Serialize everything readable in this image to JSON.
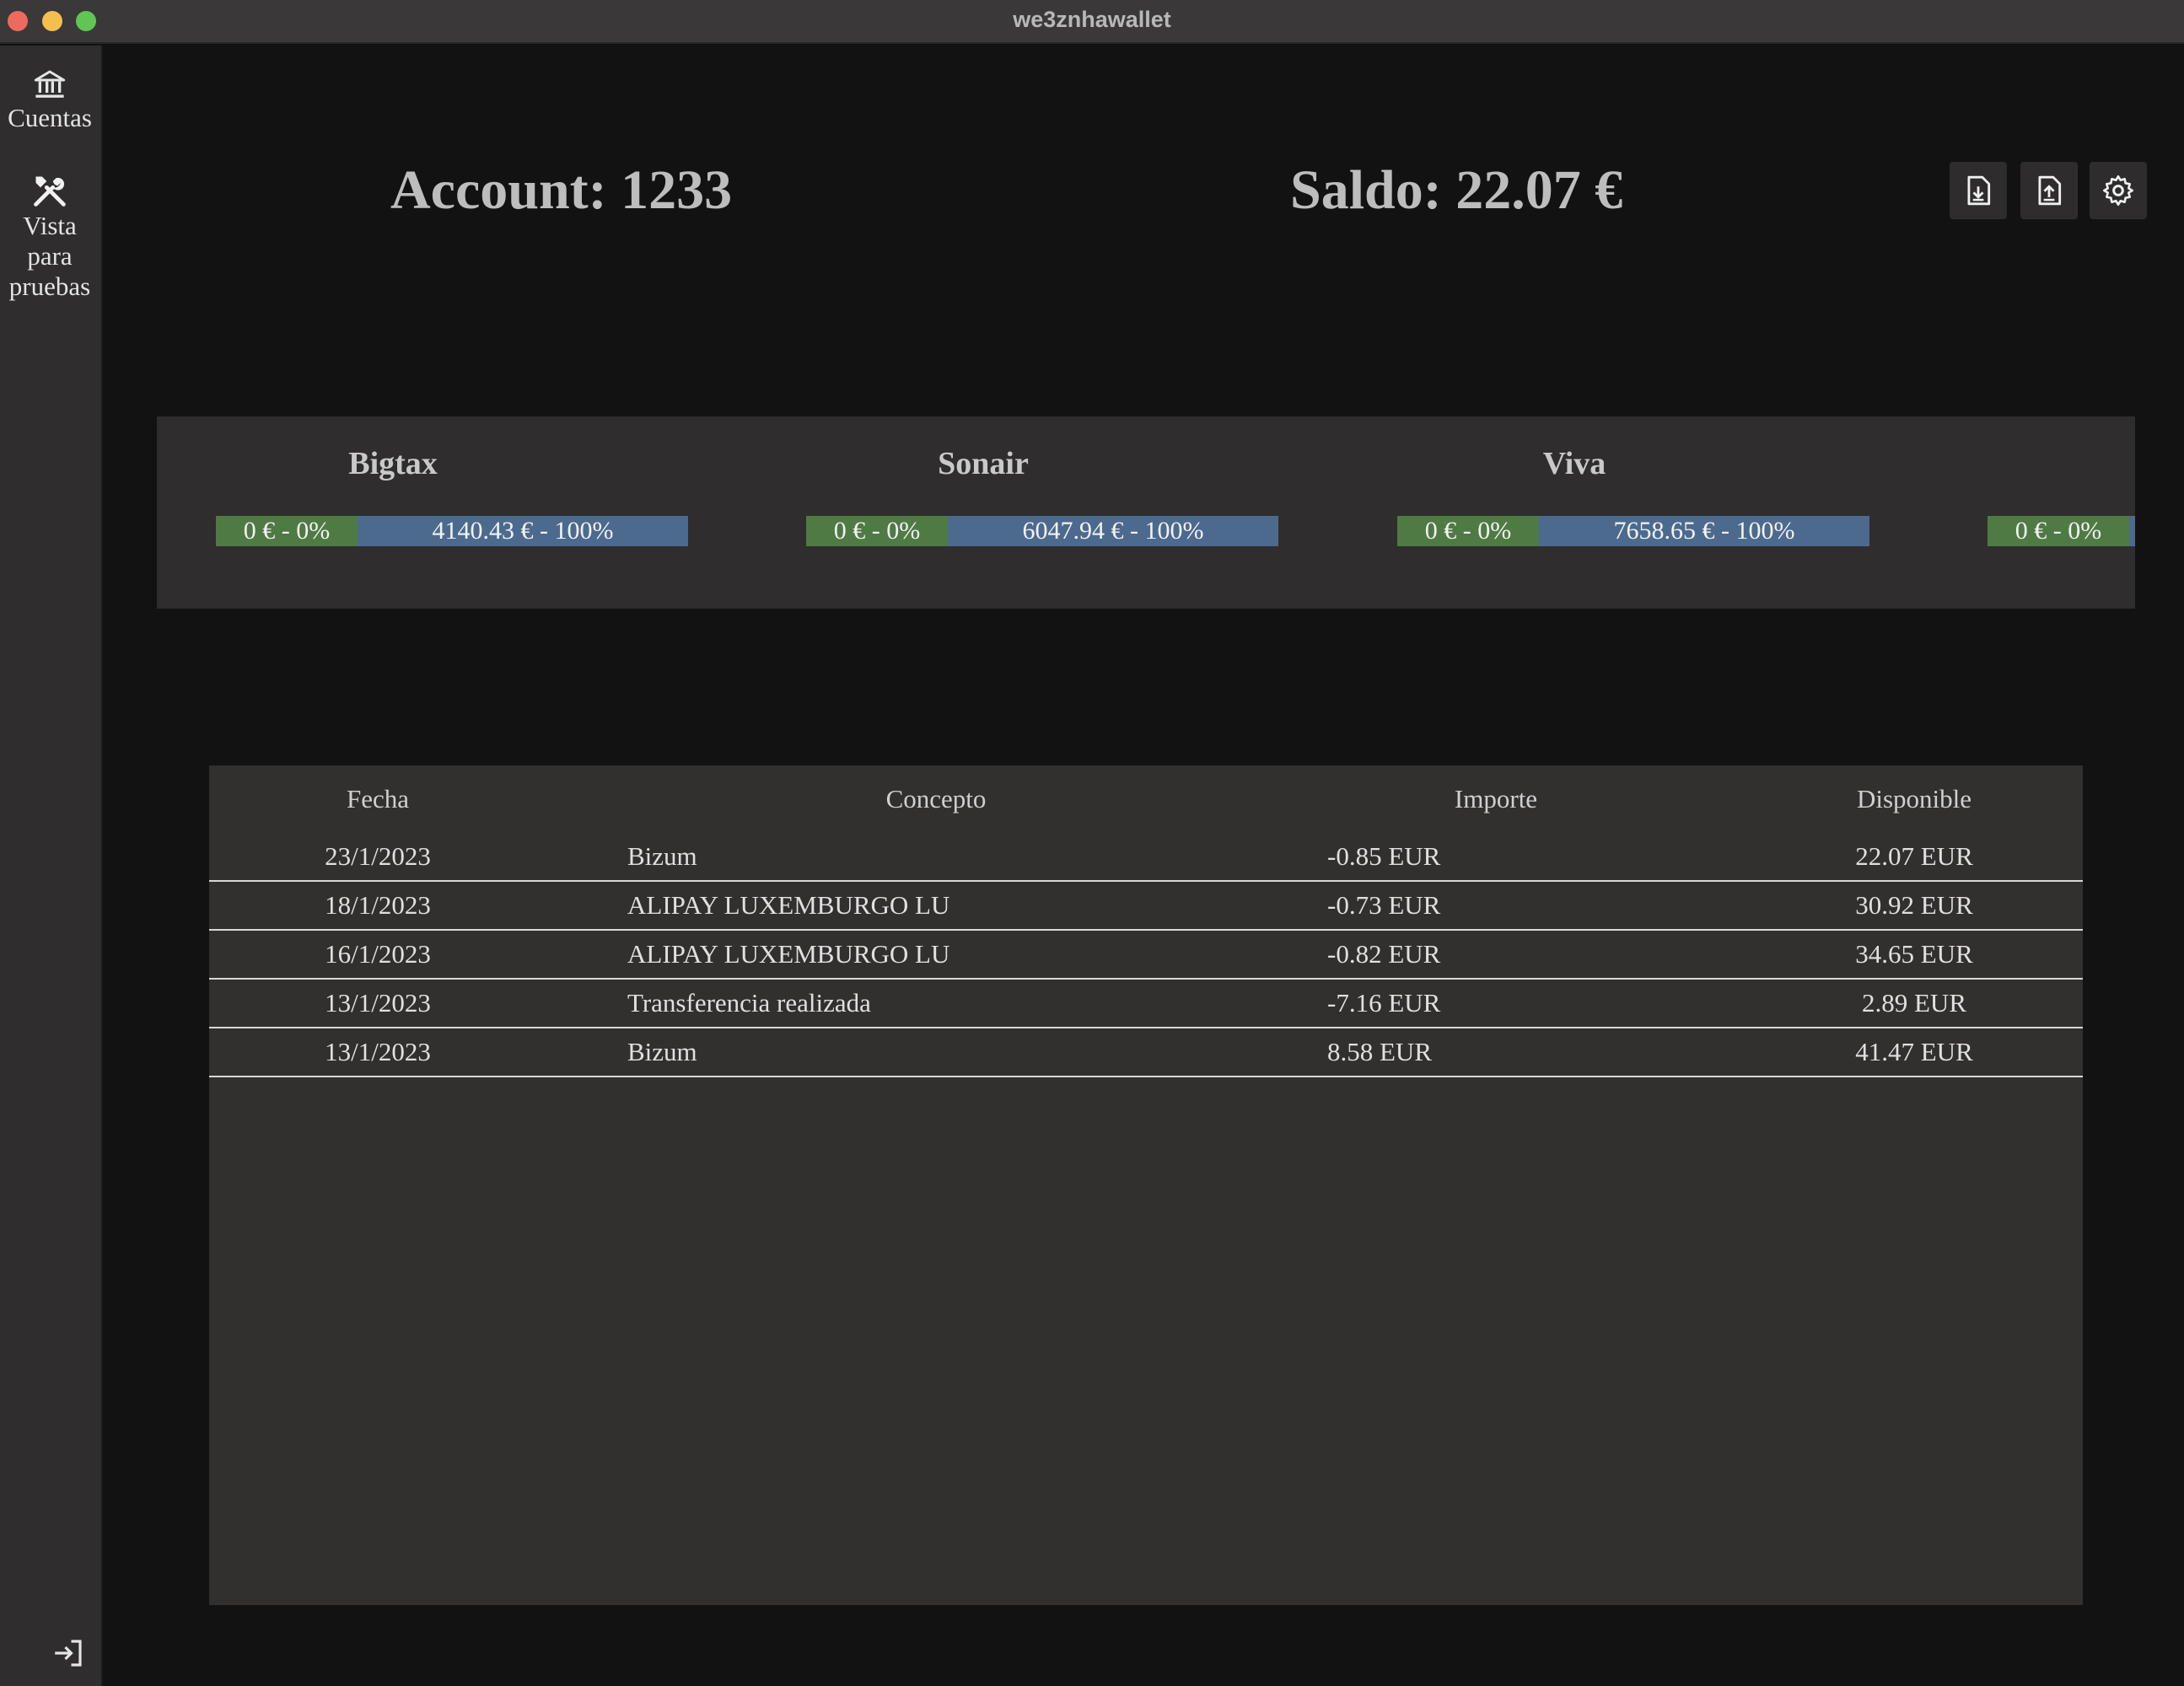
{
  "window": {
    "title": "we3znhawallet"
  },
  "sidebar": {
    "items": [
      {
        "label": "Cuentas",
        "icon": "bank-icon"
      },
      {
        "label": "Vista\npara\npruebas",
        "icon": "tools-icon"
      }
    ],
    "logout_icon": "logout-icon"
  },
  "header": {
    "account": "Account: 1233",
    "saldo": "Saldo: 22.07 €",
    "actions": [
      "import-icon",
      "export-icon",
      "gear-icon"
    ]
  },
  "budgets": [
    {
      "name": "Bigtax",
      "spent": "0 € - 0%",
      "remaining": "4140.43 € - 100%",
      "spent_fraction": 0.0
    },
    {
      "name": "Sonair",
      "spent": "0 € - 0%",
      "remaining": "6047.94 € - 100%",
      "spent_fraction": 0.0
    },
    {
      "name": "Viva",
      "spent": "0 € - 0%",
      "remaining": "7658.65 € - 100%",
      "spent_fraction": 0.0
    },
    {
      "name": "",
      "spent": "0 € - 0%",
      "remaining": "",
      "spent_fraction": 0.0
    }
  ],
  "table": {
    "headers": [
      "Fecha",
      "Concepto",
      "Importe",
      "Disponible"
    ],
    "rows": [
      [
        "23/1/2023",
        "Bizum",
        "-0.85 EUR",
        "22.07 EUR"
      ],
      [
        "18/1/2023",
        "ALIPAY LUXEMBURGO LU",
        "-0.73 EUR",
        "30.92 EUR"
      ],
      [
        "16/1/2023",
        "ALIPAY LUXEMBURGO LU",
        "-0.82 EUR",
        "34.65 EUR"
      ],
      [
        "13/1/2023",
        "Transferencia realizada",
        "-7.16 EUR",
        "2.89 EUR"
      ],
      [
        "13/1/2023",
        "Bizum",
        "8.58 EUR",
        "41.47 EUR"
      ]
    ]
  },
  "colors": {
    "background": "#121212",
    "panel": "#2f2d2d",
    "table_panel": "#322f2f",
    "spent_green": "#4f7a44",
    "remaining_blue": "#4c6a8e"
  }
}
